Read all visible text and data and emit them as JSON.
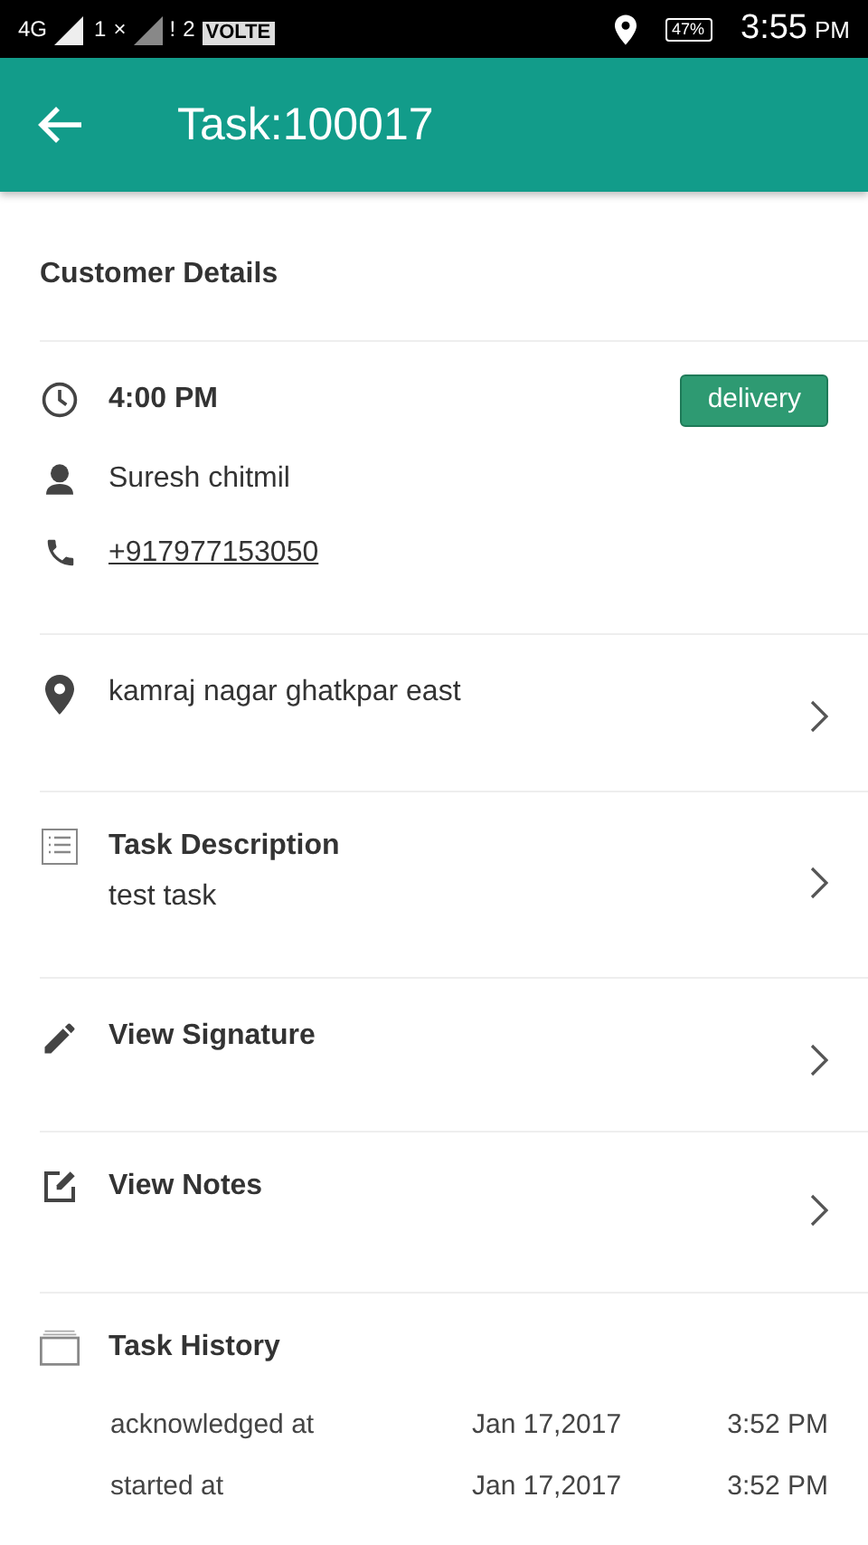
{
  "status_bar": {
    "network": "4G",
    "sim1": "1",
    "sim1_mark": "×",
    "sim2": "2",
    "sim2_mark": "!",
    "volte": "VOLTE",
    "battery": "47%",
    "time": "3:55",
    "ampm": "PM"
  },
  "app_bar": {
    "title": "Task:100017"
  },
  "section_title": "Customer Details",
  "customer": {
    "time": "4:00 PM",
    "tag": "delivery",
    "name": "Suresh chitmil",
    "phone": "+917977153050"
  },
  "rows": [
    {
      "kind": "address",
      "title": "kamraj nagar ghatkpar east"
    },
    {
      "kind": "description",
      "title": "Task Description",
      "subtitle": "test task"
    },
    {
      "kind": "signature",
      "title": "View Signature"
    },
    {
      "kind": "notes",
      "title": "View Notes"
    }
  ],
  "history": {
    "title": "Task History",
    "entries": [
      {
        "event": "acknowledged at",
        "date": "Jan 17,2017",
        "time": "3:52 PM"
      },
      {
        "event": "started at",
        "date": "Jan 17,2017",
        "time": "3:52 PM"
      }
    ]
  }
}
